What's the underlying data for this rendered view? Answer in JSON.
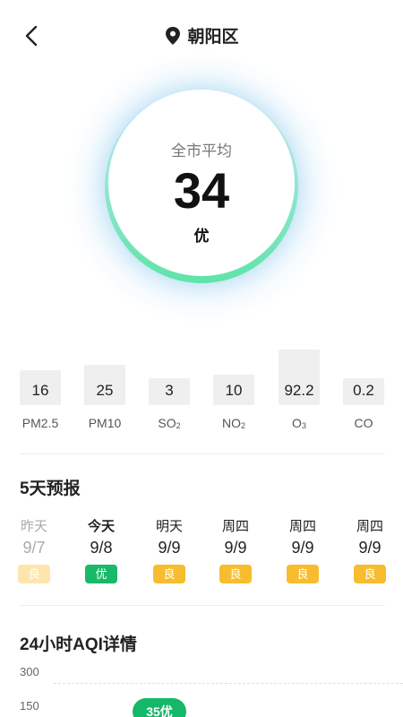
{
  "header": {
    "title": "朝阳区",
    "back_icon": "chevron-left-icon",
    "location_icon": "map-pin-icon"
  },
  "summary": {
    "label": "全市平均",
    "value": "34",
    "level": "优"
  },
  "pollutants": [
    {
      "value": "16",
      "name": "PM2.5",
      "sub": "",
      "level": 0.45
    },
    {
      "value": "25",
      "name": "PM10",
      "sub": "",
      "level": 0.58
    },
    {
      "value": "3",
      "name": "SO",
      "sub": "2",
      "level": 0.22
    },
    {
      "value": "10",
      "name": "NO",
      "sub": "2",
      "level": 0.33
    },
    {
      "value": "92.2",
      "name": "O",
      "sub": "3",
      "level": 1.0
    },
    {
      "value": "0.2",
      "name": "CO",
      "sub": "",
      "level": 0.22
    }
  ],
  "forecast": {
    "title": "5天预报",
    "days": [
      {
        "name": "昨天",
        "date": "9/7",
        "level": "良",
        "color": "#fde6ac",
        "state": "past"
      },
      {
        "name": "今天",
        "date": "9/8",
        "level": "优",
        "color": "#19b96a",
        "state": "today"
      },
      {
        "name": "明天",
        "date": "9/9",
        "level": "良",
        "color": "#f7bd2e",
        "state": "future"
      },
      {
        "name": "周四",
        "date": "9/9",
        "level": "良",
        "color": "#f7bd2e",
        "state": "future"
      },
      {
        "name": "周四",
        "date": "9/9",
        "level": "良",
        "color": "#f7bd2e",
        "state": "future"
      },
      {
        "name": "周四",
        "date": "9/9",
        "level": "良",
        "color": "#f7bd2e",
        "state": "future"
      }
    ]
  },
  "hourly": {
    "title": "24小时AQI详情",
    "y_ticks": [
      "300",
      "150"
    ],
    "current_badge": "35优",
    "badge_color": "#15b86a"
  }
}
